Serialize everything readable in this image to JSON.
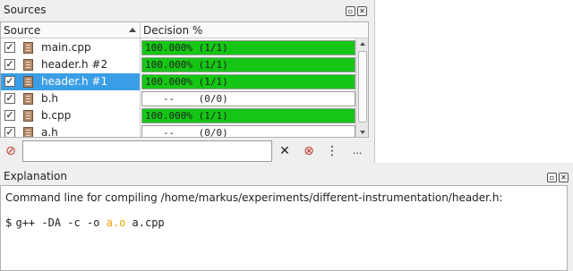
{
  "sources": {
    "title": "Sources",
    "columns": {
      "source": "Source",
      "decision": "Decision %"
    },
    "rows": [
      {
        "name": "main.cpp",
        "checked": true,
        "decision": "100.000% (1/1)",
        "full": true,
        "selected": false
      },
      {
        "name": "header.h #2",
        "checked": true,
        "decision": "100.000% (1/1)",
        "full": true,
        "selected": false
      },
      {
        "name": "header.h #1",
        "checked": true,
        "decision": "100.000% (1/1)",
        "full": true,
        "selected": true
      },
      {
        "name": "b.h",
        "checked": true,
        "decision": "   --    (0/0)",
        "full": false,
        "selected": false
      },
      {
        "name": "b.cpp",
        "checked": true,
        "decision": "100.000% (1/1)",
        "full": true,
        "selected": false
      },
      {
        "name": "a.h",
        "checked": true,
        "decision": "   --    (0/0)",
        "full": false,
        "selected": false
      }
    ],
    "filter": {
      "value": "",
      "placeholder": ""
    },
    "toolbar": {
      "more_label": "..."
    },
    "colors": {
      "covered": "#15c615",
      "selection": "#3a9ee6"
    }
  },
  "explanation": {
    "title": "Explanation",
    "command_intro": "Command line for compiling /home/markus/experiments/different-instrumentation/header.h:",
    "prompt": "$",
    "cmd_part1": "g++ -DA -c -o ",
    "cmd_output": "a.o",
    "cmd_part2": " a.cpp"
  }
}
